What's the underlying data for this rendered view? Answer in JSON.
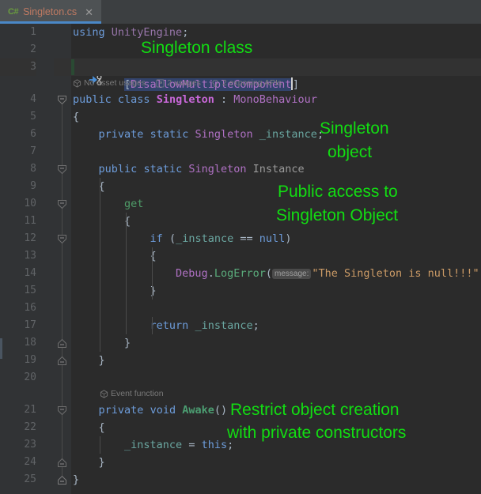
{
  "window": {
    "background": "#2b2b2b",
    "tabbar_background": "#3c3f41"
  },
  "tab": {
    "icon_label": "C#",
    "icon_name": "csharp-file-icon",
    "filename": "Singleton.cs",
    "close_glyph": "✕",
    "accent_color": "#4a88c7",
    "filename_color": "#c07a62",
    "icon_color": "#6a9c3f"
  },
  "editor": {
    "gutter_background": "#313335",
    "current_line": 3,
    "selection_color": "#32436b",
    "lines": [
      {
        "num": "1",
        "text": "using UnityEngine;"
      },
      {
        "num": "2",
        "text": ""
      },
      {
        "num": "3",
        "text": "[DisallowMultipleComponent]"
      },
      {
        "num": "4",
        "text": "public class Singleton : MonoBehaviour"
      },
      {
        "num": "5",
        "text": "{"
      },
      {
        "num": "6",
        "text": "    private static Singleton _instance;"
      },
      {
        "num": "7",
        "text": ""
      },
      {
        "num": "8",
        "text": "    public static Singleton Instance"
      },
      {
        "num": "9",
        "text": "    {"
      },
      {
        "num": "10",
        "text": "        get"
      },
      {
        "num": "11",
        "text": "        {"
      },
      {
        "num": "12",
        "text": "            if (_instance == null)"
      },
      {
        "num": "13",
        "text": "            {"
      },
      {
        "num": "14",
        "text": "                Debug.LogError( message: \"The Singleton is null!!!\");"
      },
      {
        "num": "15",
        "text": "            }"
      },
      {
        "num": "16",
        "text": ""
      },
      {
        "num": "17",
        "text": "            return _instance;"
      },
      {
        "num": "18",
        "text": "        }"
      },
      {
        "num": "19",
        "text": "    }"
      },
      {
        "num": "20",
        "text": ""
      },
      {
        "num": "21",
        "text": "    private void Awake()"
      },
      {
        "num": "22",
        "text": "    {"
      },
      {
        "num": "23",
        "text": "        _instance = this;"
      },
      {
        "num": "24",
        "text": "    }"
      },
      {
        "num": "25",
        "text": "}"
      }
    ],
    "code_tokens": {
      "l1_using": "using",
      "l1_ns": "UnityEngine",
      "l1_semi": ";",
      "l3_open": "[",
      "l3_attr": "DisallowMultipleComponent",
      "l3_close": "]",
      "l4_public": "public",
      "l4_class": "class",
      "l4_name": "Singleton",
      "l4_colon": ":",
      "l4_base": "MonoBehaviour",
      "l5_brace": "{",
      "l6_private": "private",
      "l6_static": "static",
      "l6_type": "Singleton",
      "l6_field": "_instance",
      "l6_semi": ";",
      "l8_public": "public",
      "l8_static": "static",
      "l8_type": "Singleton",
      "l8_prop": "Instance",
      "l9_brace": "{",
      "l10_get": "get",
      "l11_brace": "{",
      "l12_if": "if",
      "l12_paren_open": "(",
      "l12_field": "_instance",
      "l12_eq": "==",
      "l12_null": "null",
      "l12_paren_close": ")",
      "l13_brace": "{",
      "l14_class": "Debug",
      "l14_dot": ".",
      "l14_method": "LogError",
      "l14_paren_open": "(",
      "l14_param_hint": "message:",
      "l14_string": "\"The Singleton is null!!!\"",
      "l14_tail": ");",
      "l15_brace": "}",
      "l17_return": "return",
      "l17_field": "_instance",
      "l17_semi": ";",
      "l18_brace": "}",
      "l19_brace": "}",
      "l21_private": "private",
      "l21_void": "void",
      "l21_method": "Awake",
      "l21_parens": "()",
      "l22_brace": "{",
      "l23_field": "_instance",
      "l23_eq": "=",
      "l23_this": "this",
      "l23_semi": ";",
      "l24_brace": "}",
      "l25_brace": "}"
    },
    "inlay_hints": {
      "class_hints": [
        {
          "icon": "unity-asset-icon",
          "label": "No asset usages"
        },
        {
          "icon": "usages-icon",
          "label": "2 usages"
        },
        {
          "icon": "exposing-api-icon",
          "label": "2 exposing APIs"
        }
      ],
      "awake_hint": {
        "icon": "unity-event-icon",
        "label": "Event function"
      }
    }
  },
  "annotations": {
    "color": "#12dd12",
    "items": [
      {
        "name": "annotation-singleton-class",
        "text": "Singleton class"
      },
      {
        "name": "annotation-singleton-object-line1",
        "text": "Singleton"
      },
      {
        "name": "annotation-singleton-object-line2",
        "text": "object"
      },
      {
        "name": "annotation-public-access-line1",
        "text": "Public access to"
      },
      {
        "name": "annotation-public-access-line2",
        "text": "Singleton Object"
      },
      {
        "name": "annotation-restrict-line1",
        "text": "Restrict object creation"
      },
      {
        "name": "annotation-restrict-line2",
        "text": "with private constructors"
      }
    ]
  }
}
